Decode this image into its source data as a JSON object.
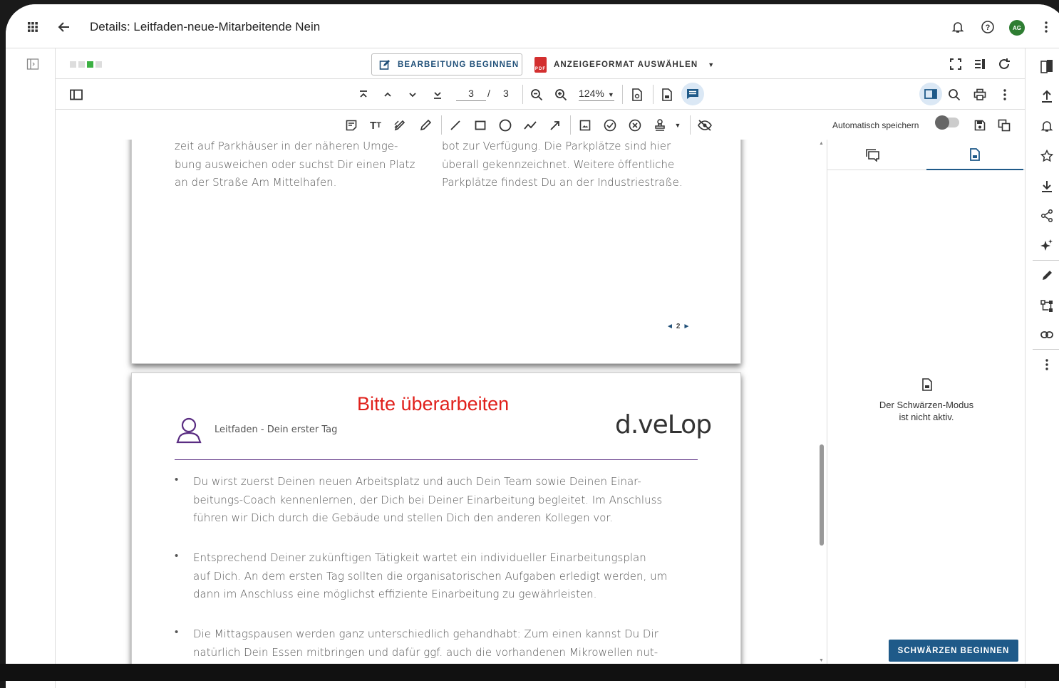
{
  "header": {
    "title": "Details: Leitfaden-neue-Mitarbeitende Nein",
    "avatar": "AG"
  },
  "toolbar": {
    "edit_label": "BEARBEITUNG BEGINNEN",
    "format_label": "ANZEIGEFORMAT AUSWÄHLEN",
    "pdf_badge": "PDF",
    "current_page": "3",
    "page_sep": "/",
    "total_pages": "3",
    "zoom": "124%",
    "autosave_label": "Automatisch speichern"
  },
  "document": {
    "page2": {
      "col1": [
        "zeit auf Parkhäuser in der näheren Umge-",
        "bung ausweichen oder suchst Dir einen Platz",
        "an der Straße Am Mittelhafen."
      ],
      "col2": [
        "bot zur Verfügung. Die Parkplätze sind hier",
        "überall gekennzeichnet. Weitere öffentliche",
        "Parkplätze findest Du an der Industriestraße."
      ],
      "page_nav": "2"
    },
    "page3": {
      "stamp": "Bitte überarbeiten",
      "header_text": "Leitfaden - Dein erster Tag",
      "logo": "d.veLop",
      "bullets": [
        [
          "Du wirst zuerst Deinen neuen Arbeitsplatz und auch Dein Team sowie Deinen Einar-",
          "beitungs-Coach kennenlernen, der Dich bei Deiner Einarbeitung begleitet. Im Anschluss",
          "führen wir Dich durch die Gebäude und stellen Dich den anderen Kollegen vor."
        ],
        [
          "Entsprechend Deiner zukünftigen Tätigkeit wartet ein individueller Einarbeitungsplan",
          "auf Dich. An dem ersten Tag sollten die organisatorischen Aufgaben erledigt werden, um",
          "dann im Anschluss eine möglichst effiziente Einarbeitung zu gewährleisten."
        ],
        [
          "Die Mittagspausen werden ganz unterschiedlich gehandhabt: Zum einen kannst Du Dir",
          "natürlich Dein Essen mitbringen und dafür ggf. auch die vorhandenen Mikrowellen nut-"
        ]
      ]
    }
  },
  "side_panel": {
    "message_line1": "Der Schwärzen-Modus",
    "message_line2": "ist nicht aktiv.",
    "redact_button": "SCHWÄRZEN BEGINNEN"
  },
  "colors": {
    "accent": "#1f5a89",
    "stamp_red": "#e0201b",
    "avatar_green": "#2e7d32"
  }
}
